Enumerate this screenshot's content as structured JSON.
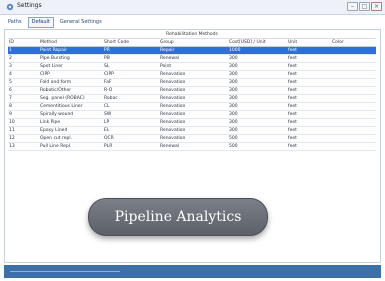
{
  "window": {
    "title": "Settings"
  },
  "tabs": [
    {
      "label": "Paths",
      "active": false
    },
    {
      "label": "Default",
      "active": true
    },
    {
      "label": "General Settings",
      "active": false
    }
  ],
  "table": {
    "section_title": "Rehabilitation Methods",
    "columns": [
      "ID",
      "Method",
      "Short Code",
      "Group",
      "Cost[USD] / Unit",
      "Unit",
      "Color"
    ],
    "rows": [
      {
        "id": "1",
        "method": "Point Repair",
        "short": "PR",
        "group": "Repair",
        "cost": "1000",
        "unit": "feet",
        "color_name": "Firebrick",
        "color": "#b22222",
        "selected": true
      },
      {
        "id": "2",
        "method": "Pipe Bursting",
        "short": "PB",
        "group": "Renewal",
        "cost": "300",
        "unit": "feet",
        "color_name": "Firebrick",
        "color": "#b22222"
      },
      {
        "id": "3",
        "method": "Spot Liner",
        "short": "SL",
        "group": "Point",
        "cost": "300",
        "unit": "feet",
        "color_name": "Red",
        "color": "#e01010"
      },
      {
        "id": "4",
        "method": "CIPP",
        "short": "CIPP",
        "group": "Renovation",
        "cost": "300",
        "unit": "feet",
        "color_name": "DarkGoldenrod",
        "color": "#b8860b"
      },
      {
        "id": "5",
        "method": "Fold and form",
        "short": "FaF",
        "group": "Renovation",
        "cost": "300",
        "unit": "feet",
        "color_name": "Red",
        "color": "#e01010"
      },
      {
        "id": "6",
        "method": "Robotic/Other",
        "short": "R-O",
        "group": "Renovation",
        "cost": "300",
        "unit": "feet",
        "color_name": "MediumBlue",
        "color": "#1f2fcc"
      },
      {
        "id": "7",
        "method": "Seg. panel (ROBAC)",
        "short": "Robac",
        "group": "Renovation",
        "cost": "300",
        "unit": "feet",
        "color_name": "Brown",
        "color": "#8b3a1a"
      },
      {
        "id": "8",
        "method": "Cementitious Liner",
        "short": "CL",
        "group": "Renovation",
        "cost": "300",
        "unit": "feet",
        "color_name": "Red",
        "color": "#e01010"
      },
      {
        "id": "9",
        "method": "Spirally wound",
        "short": "SW",
        "group": "Renovation",
        "cost": "300",
        "unit": "feet",
        "color_name": "YellowGreen",
        "color": "#9acd32"
      },
      {
        "id": "10",
        "method": "Link Pipe",
        "short": "LP",
        "group": "Renovation",
        "cost": "300",
        "unit": "feet",
        "color_name": "Red",
        "color": "#e01010"
      },
      {
        "id": "11",
        "method": "Epoxy Lined",
        "short": "EL",
        "group": "Renovation",
        "cost": "300",
        "unit": "feet",
        "color_name": "Red",
        "color": "#e01010"
      },
      {
        "id": "12",
        "method": "Open cut repl.",
        "short": "OCR",
        "group": "Renovation",
        "cost": "500",
        "unit": "feet",
        "color_name": "LightSeaGreen",
        "color": "#20b2aa"
      },
      {
        "id": "13",
        "method": "Pull Line Repl.",
        "short": "PLR",
        "group": "Renewal",
        "cost": "500",
        "unit": "feet",
        "color_name": "Red",
        "color": "#e01010"
      }
    ]
  },
  "overlay": {
    "label": "Pipeline Analytics"
  },
  "icons": {
    "app": "settings-app-icon",
    "minimize": "minimize-icon",
    "maximize": "maximize-icon",
    "close": "close-icon"
  }
}
